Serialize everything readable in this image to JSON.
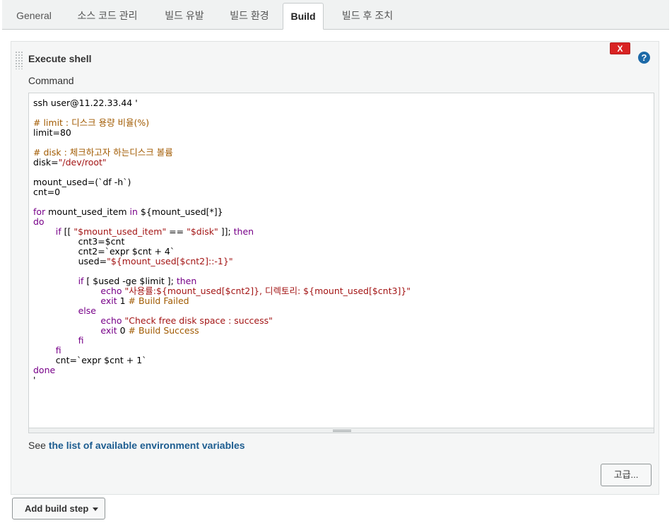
{
  "tabs": [
    {
      "label": "General"
    },
    {
      "label": "소스 코드 관리"
    },
    {
      "label": "빌드 유발"
    },
    {
      "label": "빌드 환경"
    },
    {
      "label": "Build"
    },
    {
      "label": "빌드 후 조치"
    }
  ],
  "active_tab": "Build",
  "step": {
    "title": "Execute shell",
    "delete_label": "X",
    "help_label": "?",
    "command_label": "Command",
    "command_lines": [
      "ssh user@11.22.33.44 '",
      "",
      "# limit : 디스크 용량 비율(%)",
      "limit=80",
      "",
      "# disk : 체크하고자 하는디스크 볼륨",
      "disk=\"/dev/root\"",
      "",
      "mount_used=(`df -h`)",
      "cnt=0",
      "",
      "for mount_used_item in ${mount_used[*]}",
      "do",
      "        if [[ \"$mount_used_item\" == \"$disk\" ]]; then",
      "                cnt3=$cnt",
      "                cnt2=`expr $cnt + 4`",
      "                used=\"${mount_used[$cnt2]::-1}\"",
      "",
      "                if [ $used -ge $limit ]; then",
      "                        echo \"사용률:${mount_used[$cnt2]}, 디렉토리: ${mount_used[$cnt3]}\"",
      "                        exit 1 # Build Failed",
      "                else",
      "                        echo \"Check free disk space : success\"",
      "                        exit 0 # Build Success",
      "                fi",
      "        fi",
      "        cnt=`expr $cnt + 1`",
      "done",
      "'"
    ],
    "env_prefix": "See ",
    "env_link": "the list of available environment variables",
    "advanced_label": "고급..."
  },
  "add_build_step_label": "Add build step",
  "colors": {
    "delete_red": "#d92323",
    "help_blue": "#1d6aa8",
    "link_blue": "#1d5d90",
    "comment": "#a15a00",
    "string": "#a31515",
    "keyword": "#770088"
  }
}
